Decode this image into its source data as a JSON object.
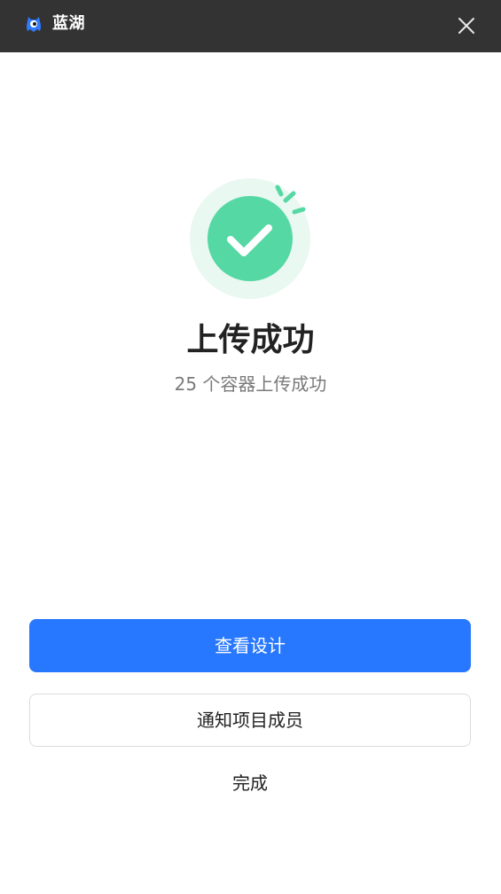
{
  "titlebar": {
    "app_name": "蓝湖",
    "logo_icon": "lanhu-logo-icon",
    "close_icon": "close-icon"
  },
  "result": {
    "icon": "success-check-icon",
    "title": "上传成功",
    "subtitle": "25 个容器上传成功"
  },
  "actions": {
    "view_design_label": "查看设计",
    "notify_members_label": "通知项目成员",
    "done_label": "完成"
  },
  "colors": {
    "titlebar_bg": "#333333",
    "primary": "#2878ff",
    "success": "#55d8a4",
    "success_halo": "#e9f8f1"
  }
}
